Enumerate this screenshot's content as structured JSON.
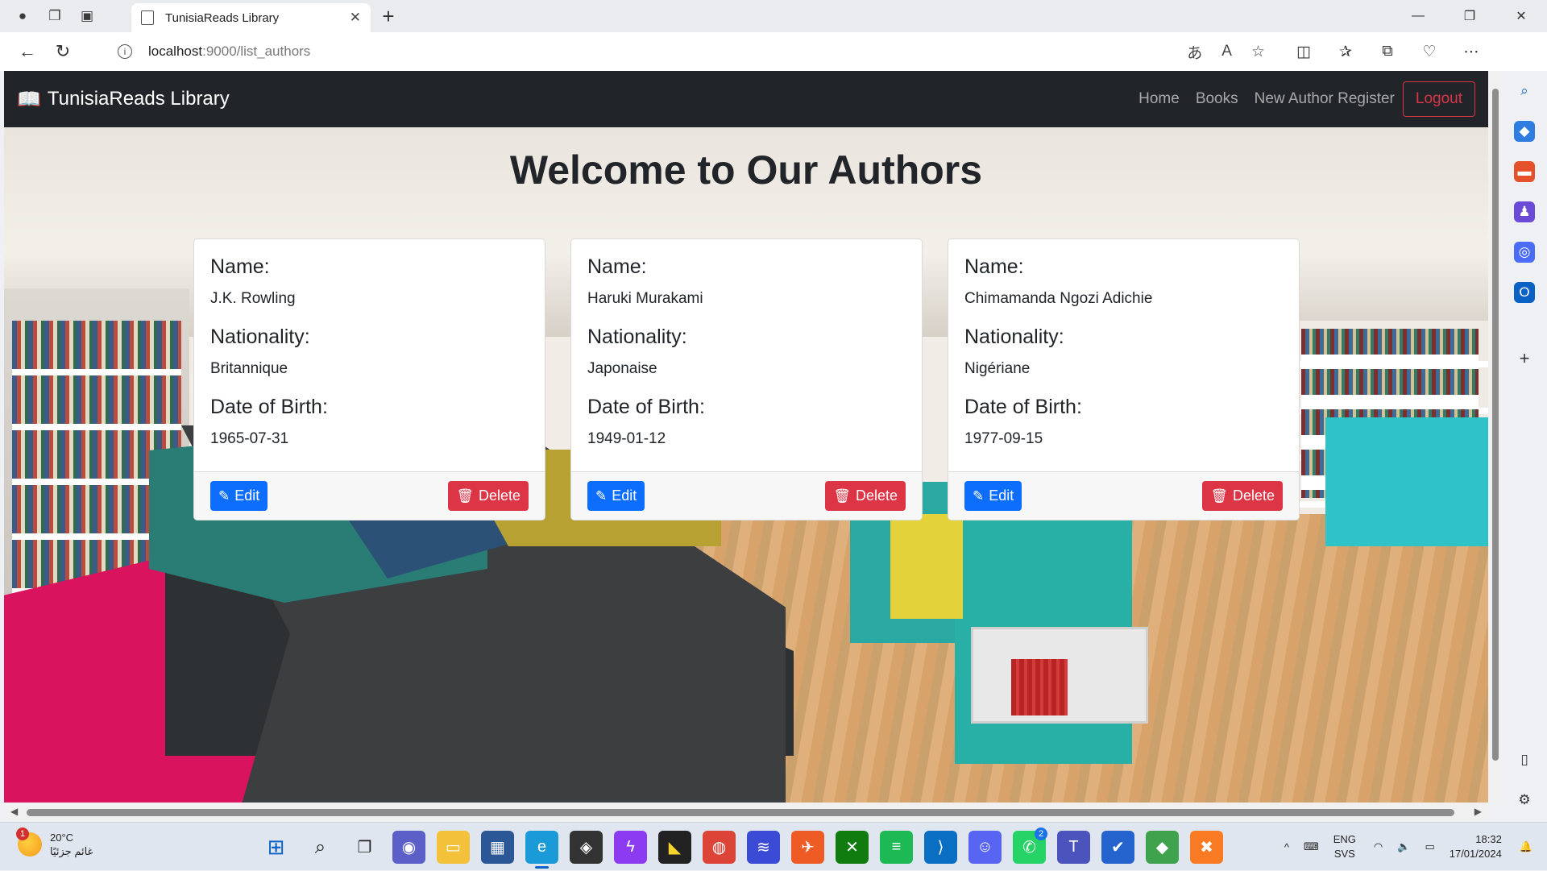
{
  "browser": {
    "tab_title": "TunisiaReads Library",
    "url_host": "localhost",
    "url_rest": ":9000/list_authors"
  },
  "navbar": {
    "brand": "TunisiaReads Library",
    "links": [
      "Home",
      "Books",
      "New Author Register"
    ],
    "logout": "Logout"
  },
  "page": {
    "heading": "Welcome to Our Authors",
    "labels": {
      "name": "Name:",
      "nationality": "Nationality:",
      "dob": "Date of Birth:"
    },
    "edit_label": "Edit",
    "delete_label": "Delete"
  },
  "authors": [
    {
      "name": "J.K. Rowling",
      "nationality": "Britannique",
      "dob": "1965-07-31"
    },
    {
      "name": "Haruki Murakami",
      "nationality": "Japonaise",
      "dob": "1949-01-12"
    },
    {
      "name": "Chimamanda Ngozi Adichie",
      "nationality": "Nigériane",
      "dob": "1977-09-15"
    }
  ],
  "taskbar": {
    "temperature": "20°C",
    "weather_text": "غائم جزئيًا",
    "weather_badge": "1",
    "lang": "ENG",
    "lang2": "SVS",
    "time": "18:32",
    "date": "17/01/2024",
    "whatsapp_badge": "2"
  },
  "colors": {
    "primary": "#0d6efd",
    "danger": "#dc3545",
    "navbar": "#212529"
  }
}
